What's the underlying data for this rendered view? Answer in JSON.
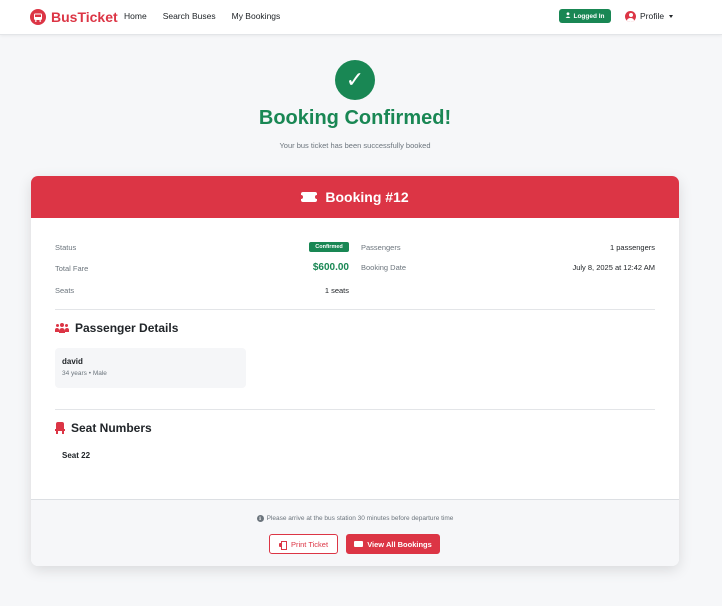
{
  "navbar": {
    "brand": "BusTicket",
    "links": [
      "Home",
      "Search Buses",
      "My Bookings"
    ],
    "logged_in": "Logged In",
    "profile": "Profile"
  },
  "hero": {
    "check": "✓",
    "title": "Booking Confirmed!",
    "subtitle": "Your bus ticket has been successfully booked"
  },
  "booking": {
    "header": "Booking #12",
    "status_label": "Status",
    "status_value": "Confirmed",
    "total_fare_label": "Total Fare",
    "total_fare_value": "$600.00",
    "seats_label": "Seats",
    "seats_value": "1 seats",
    "passengers_label": "Passengers",
    "passengers_value": "1 passengers",
    "booking_date_label": "Booking Date",
    "booking_date_value": "July 8, 2025 at 12:42 AM"
  },
  "passenger_details": {
    "title": "Passenger Details",
    "passengers": [
      {
        "name": "david",
        "meta": "34 years • Male"
      }
    ]
  },
  "seat_numbers": {
    "title": "Seat Numbers",
    "seats": [
      "Seat 22"
    ]
  },
  "footer": {
    "note": "Please arrive at the bus station 30 minutes before departure time",
    "print_button": "Print Ticket",
    "view_all_button": "View All Bookings"
  },
  "colors": {
    "brand": "#dc3545",
    "success": "#198754",
    "muted": "#6c757d"
  },
  "icons": [
    "bus-icon",
    "user-check-icon",
    "user-circle-icon",
    "check-icon",
    "ticket-icon",
    "users-icon",
    "seat-icon",
    "info-icon",
    "printer-icon"
  ]
}
